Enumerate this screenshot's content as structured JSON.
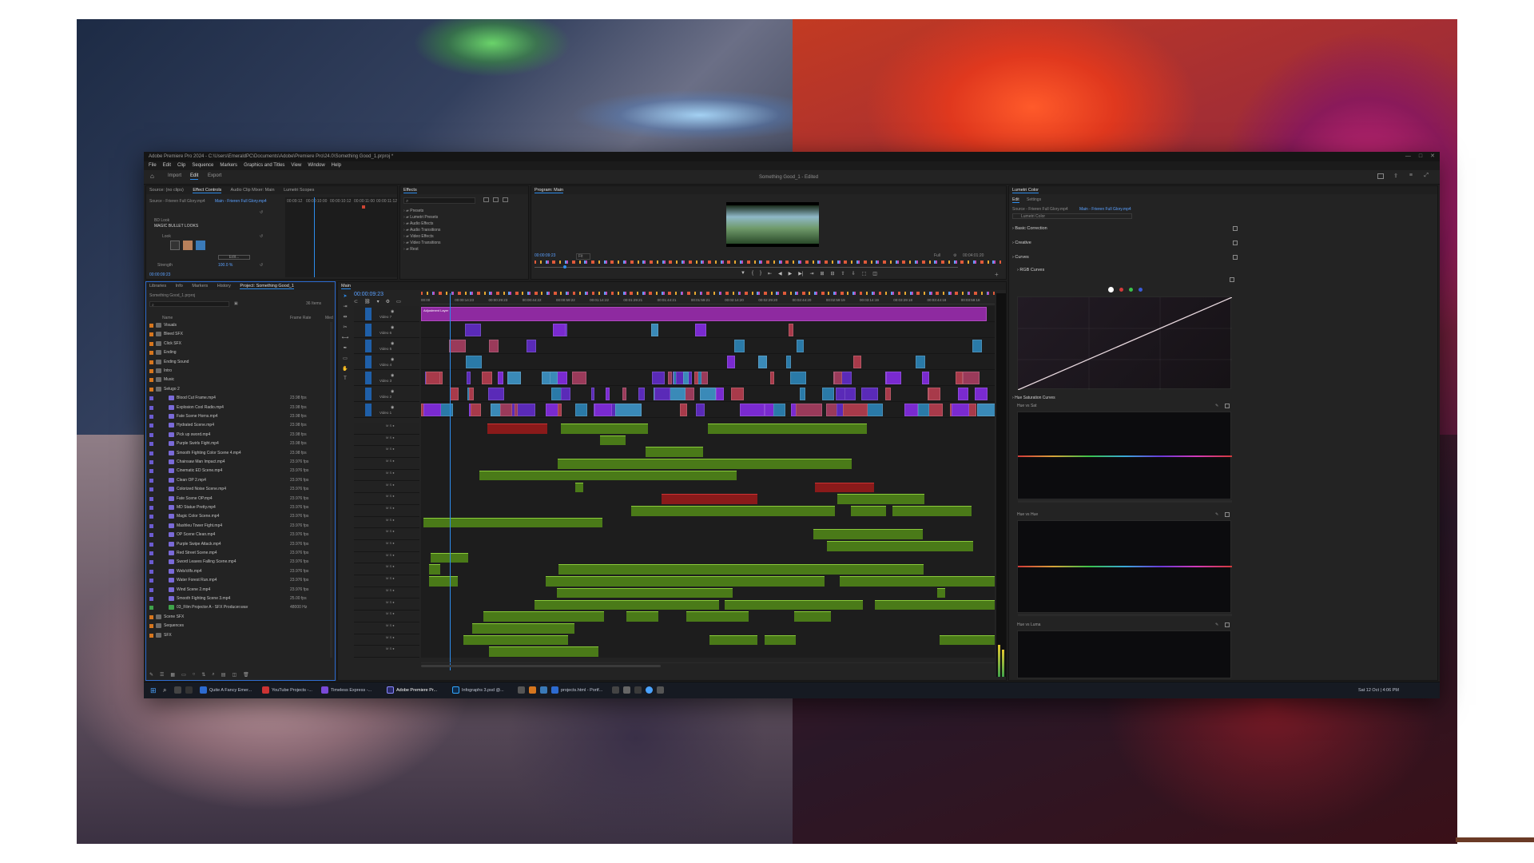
{
  "window": {
    "title": "Adobe Premiere Pro 2024 - C:\\Users\\EmeraldPC\\Documents\\Adobe\\Premiere Pro\\24.0\\Something Good_1.prproj *",
    "doc_title": "Something Good_1 - Edited",
    "controls": [
      "—",
      "□",
      "✕"
    ]
  },
  "menu": [
    "File",
    "Edit",
    "Clip",
    "Sequence",
    "Markers",
    "Graphics and Titles",
    "View",
    "Window",
    "Help"
  ],
  "workspace_tabs": [
    "Import",
    "Edit",
    "Export"
  ],
  "active_workspace": "Edit",
  "effect_controls": {
    "tabs": [
      "Source: (no clips)",
      "Effect Controls",
      "Audio Clip Mixer: Main",
      "Lumetri Scopes"
    ],
    "source_label": "Source - Frieren Full Glory.mp4",
    "clip_label": "Main - Frieren Full Glory.mp4",
    "timecodes": [
      "00:09:12",
      "00:00:10:00",
      "00:00:10:12",
      "00:00:11:00",
      "00:00:11:12",
      "00:0"
    ],
    "effect_name_small": "BD Look",
    "effect_name": "MAGIC BULLET LOOKS",
    "look_label": "Look",
    "edit_button": "Edit...",
    "strength_label": "Strength",
    "strength_value": "100.0 %",
    "current_time": "00:00:09:23"
  },
  "effects": {
    "tab": "Effects",
    "folders": [
      "Presets",
      "Lumetri Presets",
      "Audio Effects",
      "Audio Transitions",
      "Video Effects",
      "Video Transitions",
      "Rest"
    ]
  },
  "program": {
    "tab": "Program: Main",
    "timecode": "00:00:09:23",
    "fit": "Fit",
    "quality": "Full",
    "duration": "00:04:01:20"
  },
  "project": {
    "tabs": [
      "Libraries",
      "Info",
      "Markers",
      "History",
      "Project: Something Good_1"
    ],
    "file": "Something Good_1.prproj",
    "items_count": "36 Items",
    "col_name": "Name",
    "col_fps": "Frame Rate",
    "col_media": "Med",
    "items": [
      {
        "name": "Visuals",
        "type": "bin",
        "color": "#d6761e",
        "fps": ""
      },
      {
        "name": "Bleed SFX",
        "type": "bin",
        "color": "#d6761e",
        "fps": ""
      },
      {
        "name": "Click SFX",
        "type": "bin",
        "color": "#d6761e",
        "fps": ""
      },
      {
        "name": "Ending",
        "type": "bin",
        "color": "#d6761e",
        "fps": ""
      },
      {
        "name": "Ending Sound",
        "type": "bin",
        "color": "#d6761e",
        "fps": ""
      },
      {
        "name": "Intro",
        "type": "bin",
        "color": "#d6761e",
        "fps": ""
      },
      {
        "name": "Music",
        "type": "bin",
        "color": "#d6761e",
        "fps": ""
      },
      {
        "name": "Selugo 2",
        "type": "bin",
        "color": "#d6761e",
        "fps": ""
      },
      {
        "name": "Blood Cut Frame.mp4",
        "type": "clip",
        "color": "#6b5bd0",
        "fps": "23.98 fps"
      },
      {
        "name": "Explosion Cool Radio.mp4",
        "type": "clip",
        "color": "#6b5bd0",
        "fps": "23.98 fps"
      },
      {
        "name": "Fate Scene Horns.mp4",
        "type": "clip",
        "color": "#6b5bd0",
        "fps": "23.98 fps"
      },
      {
        "name": "Hydrated Scene.mp4",
        "type": "clip",
        "color": "#6b5bd0",
        "fps": "23.98 fps"
      },
      {
        "name": "Pick up sword.mp4",
        "type": "clip",
        "color": "#6b5bd0",
        "fps": "23.98 fps"
      },
      {
        "name": "Purple Swirls Fight.mp4",
        "type": "clip",
        "color": "#6b5bd0",
        "fps": "23.98 fps"
      },
      {
        "name": "Smooth Fighting Color Scene 4.mp4",
        "type": "clip",
        "color": "#6b5bd0",
        "fps": "23.98 fps"
      },
      {
        "name": "Chainsaw Man Impact.mp4",
        "type": "clip",
        "color": "#6b5bd0",
        "fps": "23.976 fps"
      },
      {
        "name": "Cinematic ED Scene.mp4",
        "type": "clip",
        "color": "#6b5bd0",
        "fps": "23.976 fps"
      },
      {
        "name": "Clean OP 2.mp4",
        "type": "clip",
        "color": "#6b5bd0",
        "fps": "23.976 fps"
      },
      {
        "name": "Colorized Noise Scene.mp4",
        "type": "clip",
        "color": "#6b5bd0",
        "fps": "23.976 fps"
      },
      {
        "name": "Fate Scene OP.mp4",
        "type": "clip",
        "color": "#6b5bd0",
        "fps": "23.976 fps"
      },
      {
        "name": "MD Statue Pretty.mp4",
        "type": "clip",
        "color": "#6b5bd0",
        "fps": "23.976 fps"
      },
      {
        "name": "Magic Color Scene.mp4",
        "type": "clip",
        "color": "#6b5bd0",
        "fps": "23.976 fps"
      },
      {
        "name": "Mashleu Tower Fight.mp4",
        "type": "clip",
        "color": "#6b5bd0",
        "fps": "23.976 fps"
      },
      {
        "name": "OP Scene Clean.mp4",
        "type": "clip",
        "color": "#6b5bd0",
        "fps": "23.976 fps"
      },
      {
        "name": "Purple Swipe Attack.mp4",
        "type": "clip",
        "color": "#6b5bd0",
        "fps": "23.976 fps"
      },
      {
        "name": "Red Street Scene.mp4",
        "type": "clip",
        "color": "#6b5bd0",
        "fps": "23.976 fps"
      },
      {
        "name": "Sword Leaves Falling Scene.mp4",
        "type": "clip",
        "color": "#6b5bd0",
        "fps": "23.976 fps"
      },
      {
        "name": "Web/ctlfs.mp4",
        "type": "clip",
        "color": "#6b5bd0",
        "fps": "23.976 fps"
      },
      {
        "name": "Water Forest Run.mp4",
        "type": "clip",
        "color": "#6b5bd0",
        "fps": "23.976 fps"
      },
      {
        "name": "Wind Scene 2.mp4",
        "type": "clip",
        "color": "#6b5bd0",
        "fps": "23.976 fps"
      },
      {
        "name": "Smooth Fighting Scene 3.mp4",
        "type": "clip",
        "color": "#6b5bd0",
        "fps": "25.00 fps"
      },
      {
        "name": "03_Film Projector A - SFX Producer.wav",
        "type": "audio",
        "color": "#3fa34a",
        "fps": "48000 Hz"
      },
      {
        "name": "Scene SFX",
        "type": "bin",
        "color": "#d6761e",
        "fps": ""
      },
      {
        "name": "Sequences",
        "type": "bin",
        "color": "#d6761e",
        "fps": ""
      },
      {
        "name": "SFX",
        "type": "bin",
        "color": "#d6761e",
        "fps": ""
      }
    ]
  },
  "timeline": {
    "tab": "Main",
    "timecode": "00:00:09:23",
    "ruler": [
      "00:00",
      "00:00:14:23",
      "00:00:29:23",
      "00:00:44:22",
      "00:00:59:22",
      "00:01:14:22",
      "00:01:29:21",
      "00:01:44:21",
      "00:01:59:21",
      "00:02:14:20",
      "00:02:29:20",
      "00:02:44:20",
      "00:02:59:19",
      "00:03:14:19",
      "00:03:29:18",
      "00:03:44:18",
      "00:03:59:18"
    ],
    "video_tracks": [
      "Video 7",
      "Video 6",
      "Video 5",
      "Video 4",
      "Video 3",
      "Video 2",
      "Video 1"
    ],
    "adjustment_label": "Adjustment Layer",
    "audio_track_count": 20
  },
  "lumetri": {
    "tab": "Lumetri Color",
    "subtabs": [
      "Edit",
      "Settings"
    ],
    "source_label": "Source - Frieren Full Glory.mp4",
    "clip_label": "Main - Frieren Full Glory.mp4",
    "effect_select": "Lumetri Color",
    "sections": [
      "Basic Correction",
      "Creative",
      "Curves",
      "RGB Curves"
    ],
    "hue_sat_label": "Hue Saturation Curves",
    "curve1": "Hue vs Sat",
    "curve2": "Hue vs Hue",
    "curve3": "Hue vs Luma",
    "channel_colors": [
      "#ffffff",
      "#d23a3a",
      "#3ac24a",
      "#3a5ad8"
    ]
  },
  "taskbar": {
    "items": [
      "Quite A Fancy Emer...",
      "YouTube Projects -...",
      "Timeless Express -...",
      "Adobe Premiere Pr...",
      "Infographs 3.psd @...",
      "projects.html - Portf..."
    ],
    "clock": "Sat 12 Oct | 4:06 PM"
  }
}
